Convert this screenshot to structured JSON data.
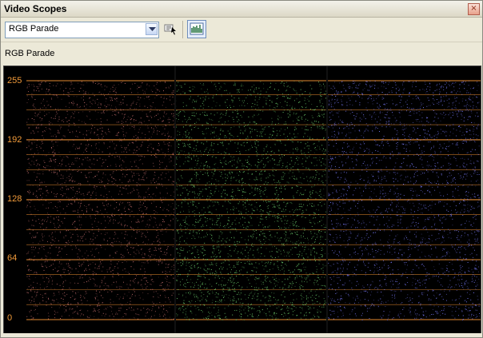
{
  "window": {
    "title": "Video Scopes",
    "close_symbol": "×"
  },
  "toolbar": {
    "scope_select": {
      "value": "RGB Parade"
    },
    "pick_button_icon": "pick-icon",
    "scope_button_icon": "waveform-icon"
  },
  "scope": {
    "label": "RGB Parade",
    "axis": {
      "ticks": [
        "255",
        "192",
        "128",
        "64",
        "0"
      ]
    },
    "colors": {
      "red": "#c87070",
      "green": "#72d872",
      "blue": "#7b7cff",
      "grid": "#e48a2f"
    }
  }
}
